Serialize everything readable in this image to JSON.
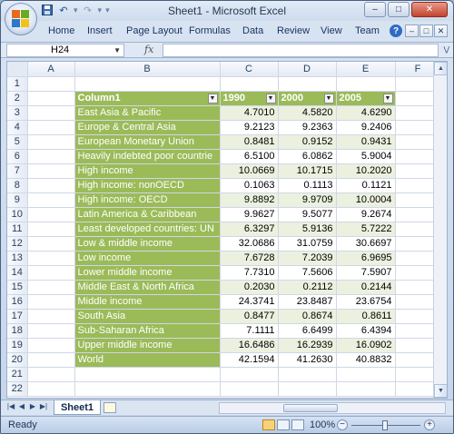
{
  "window": {
    "title": "Sheet1 - Microsoft Excel",
    "controls": {
      "minimize": "–",
      "restore": "□",
      "close": "✕"
    }
  },
  "qat": {
    "icons": [
      "save-icon",
      "undo-icon",
      "redo-icon"
    ]
  },
  "menu": {
    "tabs": [
      "Home",
      "Insert",
      "Page Layout",
      "Formulas",
      "Data",
      "Review",
      "View",
      "Team"
    ],
    "help": "?",
    "ribbon_controls": [
      "–",
      "□",
      "✕"
    ]
  },
  "formula_bar": {
    "name_box": "H24",
    "fx": "fx",
    "formula": ""
  },
  "grid": {
    "columns": [
      "A",
      "B",
      "C",
      "D",
      "E",
      "F"
    ],
    "rows": [
      "1",
      "2",
      "3",
      "4",
      "5",
      "6",
      "7",
      "8",
      "9",
      "10",
      "11",
      "12",
      "13",
      "14",
      "15",
      "16",
      "17",
      "18",
      "19",
      "20",
      "21",
      "22"
    ],
    "table_header": [
      "Column1",
      "1990",
      "2000",
      "2005"
    ],
    "table_rows": [
      [
        "East Asia & Pacific",
        "4.7010",
        "4.5820",
        "4.6290"
      ],
      [
        "Europe & Central Asia",
        "9.2123",
        "9.2363",
        "9.2406"
      ],
      [
        "European Monetary Union",
        "0.8481",
        "0.9152",
        "0.9431"
      ],
      [
        "Heavily indebted poor countrie",
        "6.5100",
        "6.0862",
        "5.9004"
      ],
      [
        "High income",
        "10.0669",
        "10.1715",
        "10.2020"
      ],
      [
        "High income: nonOECD",
        "0.1063",
        "0.1113",
        "0.1121"
      ],
      [
        "High income: OECD",
        "9.8892",
        "9.9709",
        "10.0004"
      ],
      [
        "Latin America & Caribbean",
        "9.9627",
        "9.5077",
        "9.2674"
      ],
      [
        "Least developed countries: UN",
        "6.3297",
        "5.9136",
        "5.7222"
      ],
      [
        "Low & middle income",
        "32.0686",
        "31.0759",
        "30.6697"
      ],
      [
        "Low income",
        "7.6728",
        "7.2039",
        "6.9695"
      ],
      [
        "Lower middle income",
        "7.7310",
        "7.5606",
        "7.5907"
      ],
      [
        "Middle East & North Africa",
        "0.2030",
        "0.2112",
        "0.2144"
      ],
      [
        "Middle income",
        "24.3741",
        "23.8487",
        "23.6754"
      ],
      [
        "South Asia",
        "0.8477",
        "0.8674",
        "0.8611"
      ],
      [
        "Sub-Saharan Africa",
        "7.1111",
        "6.6499",
        "6.4394"
      ],
      [
        "Upper middle income",
        "16.6486",
        "16.2939",
        "16.0902"
      ],
      [
        "World",
        "42.1594",
        "41.2630",
        "40.8832"
      ]
    ]
  },
  "sheets": {
    "active": "Sheet1"
  },
  "status": {
    "mode": "Ready",
    "zoom": "100%",
    "zoom_minus": "−",
    "zoom_plus": "+"
  },
  "colors": {
    "table_header": "#9bbb59",
    "table_band": "#ebf1de"
  }
}
